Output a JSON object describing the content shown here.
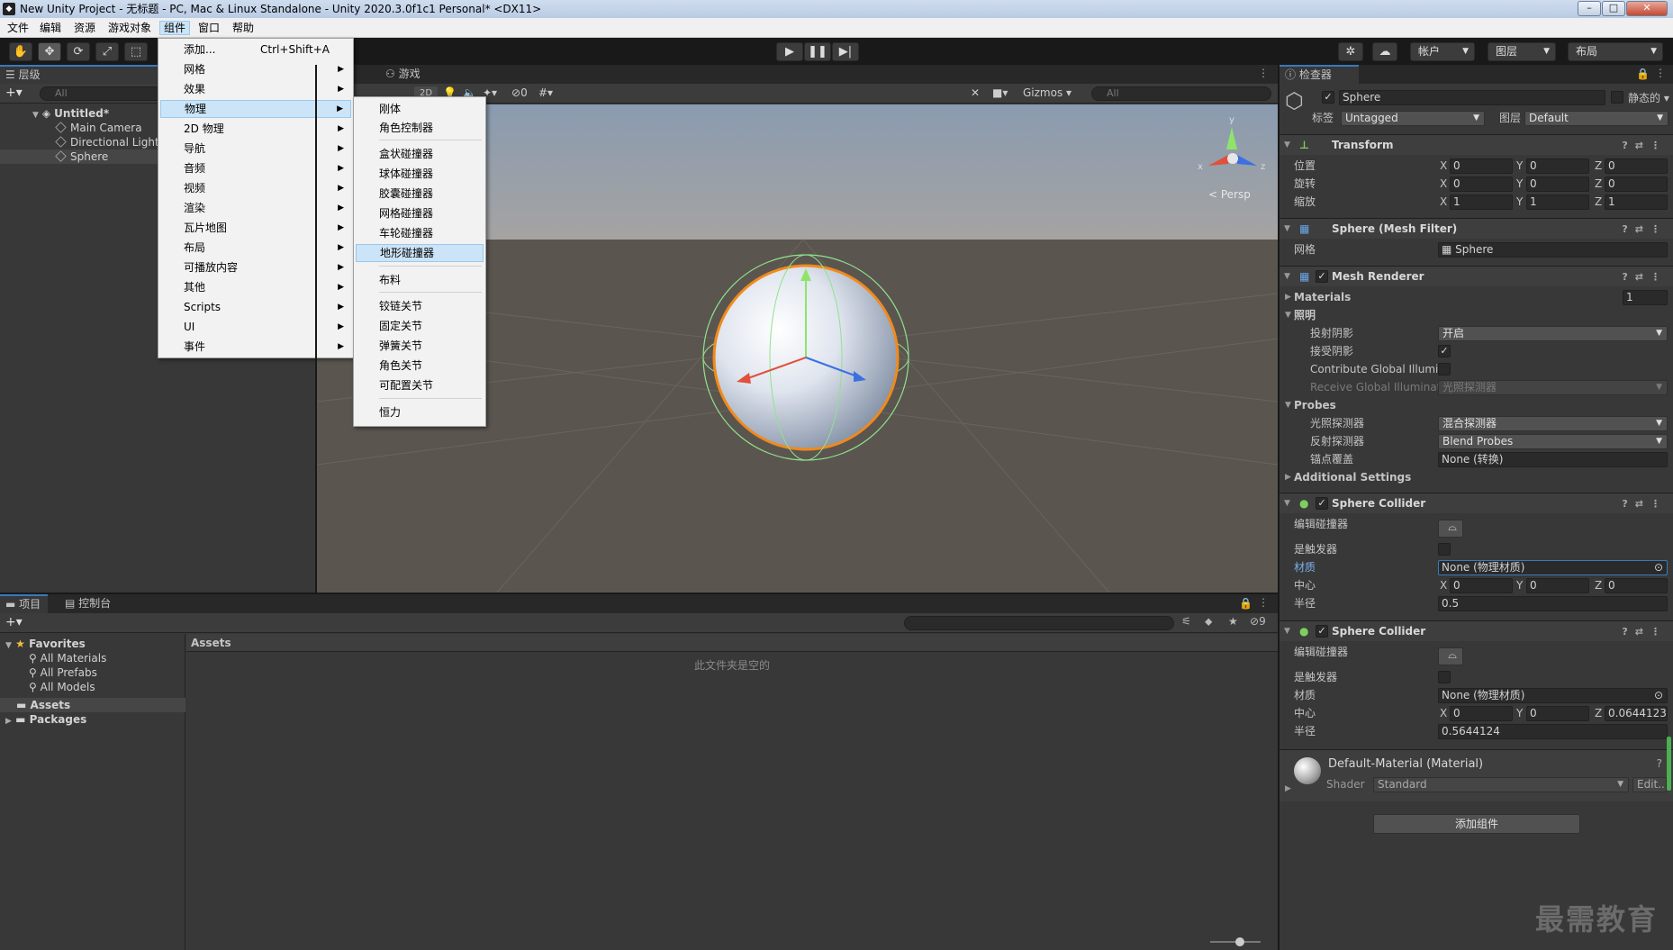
{
  "window": {
    "title": "New Unity Project - 无标题 - PC, Mac & Linux Standalone - Unity 2020.3.0f1c1 Personal* <DX11>",
    "app_icon": "unity-icon"
  },
  "menubar": {
    "items": [
      "文件",
      "编辑",
      "资源",
      "游戏对象",
      "组件",
      "窗口",
      "帮助"
    ],
    "active": "组件"
  },
  "toolbar": {
    "account": "帐户",
    "layers": "图层",
    "layout": "布局"
  },
  "hierarchy": {
    "tab": "层级",
    "search_placeholder": "All",
    "scene": "Untitled*",
    "items": [
      "Main Camera",
      "Directional Light",
      "Sphere"
    ],
    "selected": "Sphere"
  },
  "scene_view": {
    "game_tab": "游戏",
    "mode_2d": "2D",
    "hidden_count": "0",
    "gizmos": "Gizmos",
    "search_placeholder": "All",
    "persp_label": "< Persp",
    "axes": {
      "x": "x",
      "y": "y",
      "z": "z"
    }
  },
  "component_menu": {
    "items": [
      {
        "label": "添加...",
        "shortcut": "Ctrl+Shift+A",
        "submenu": false
      },
      {
        "label": "网格",
        "submenu": true
      },
      {
        "label": "效果",
        "submenu": true
      },
      {
        "label": "物理",
        "submenu": true,
        "highlighted": true
      },
      {
        "label": "2D 物理",
        "submenu": true
      },
      {
        "label": "导航",
        "submenu": true
      },
      {
        "label": "音频",
        "submenu": true
      },
      {
        "label": "视频",
        "submenu": true
      },
      {
        "label": "渲染",
        "submenu": true
      },
      {
        "label": "瓦片地图",
        "submenu": true
      },
      {
        "label": "布局",
        "submenu": true
      },
      {
        "label": "可播放内容",
        "submenu": true
      },
      {
        "label": "其他",
        "submenu": true
      },
      {
        "label": "Scripts",
        "submenu": true
      },
      {
        "label": "UI",
        "submenu": true
      },
      {
        "label": "事件",
        "submenu": true
      }
    ]
  },
  "physics_menu": {
    "groups": [
      [
        "刚体",
        "角色控制器"
      ],
      [
        "盒状碰撞器",
        "球体碰撞器",
        "胶囊碰撞器",
        "网格碰撞器",
        "车轮碰撞器",
        "地形碰撞器"
      ],
      [
        "布料"
      ],
      [
        "铰链关节",
        "固定关节",
        "弹簧关节",
        "角色关节",
        "可配置关节"
      ],
      [
        "恒力"
      ]
    ],
    "highlighted": "地形碰撞器"
  },
  "project": {
    "tabs": [
      "项目",
      "控制台"
    ],
    "hidden_count": "9",
    "favorites_label": "Favorites",
    "favorites": [
      "All Materials",
      "All Prefabs",
      "All Models"
    ],
    "folders": [
      "Assets",
      "Packages"
    ],
    "breadcrumb": "Assets",
    "empty_message": "此文件夹是空的"
  },
  "inspector": {
    "tab": "检查器",
    "object_name": "Sphere",
    "static_label": "静态的",
    "tag_label": "标签",
    "tag_value": "Untagged",
    "layer_label": "图层",
    "layer_value": "Default",
    "transform": {
      "title": "Transform",
      "rows": [
        {
          "label": "位置",
          "x": "0",
          "y": "0",
          "z": "0"
        },
        {
          "label": "旋转",
          "x": "0",
          "y": "0",
          "z": "0"
        },
        {
          "label": "缩放",
          "x": "1",
          "y": "1",
          "z": "1"
        }
      ]
    },
    "mesh_filter": {
      "title": "Sphere (Mesh Filter)",
      "mesh_label": "网格",
      "mesh_value": "Sphere"
    },
    "mesh_renderer": {
      "title": "Mesh Renderer",
      "materials_label": "Materials",
      "materials_count": "1",
      "lighting_label": "照明",
      "cast_shadows_label": "投射阴影",
      "cast_shadows_value": "开启",
      "receive_shadows_label": "接受阴影",
      "contribute_gi_label": "Contribute Global Illumir",
      "receive_gi_label": "Receive Global Illuminati",
      "receive_gi_value": "光照探测器",
      "probes_label": "Probes",
      "light_probes_label": "光照探测器",
      "light_probes_value": "混合探测器",
      "reflection_probes_label": "反射探测器",
      "reflection_probes_value": "Blend Probes",
      "anchor_override_label": "锚点覆盖",
      "anchor_override_value": "None (转换)",
      "additional_settings_label": "Additional Settings"
    },
    "sphere_collider_1": {
      "title": "Sphere Collider",
      "edit_label": "编辑碰撞器",
      "trigger_label": "是触发器",
      "material_label": "材质",
      "material_value": "None (物理材质)",
      "center_label": "中心",
      "center": {
        "x": "0",
        "y": "0",
        "z": "0"
      },
      "radius_label": "半径",
      "radius": "0.5"
    },
    "sphere_collider_2": {
      "title": "Sphere Collider",
      "edit_label": "编辑碰撞器",
      "trigger_label": "是触发器",
      "material_label": "材质",
      "material_value": "None (物理材质)",
      "center_label": "中心",
      "center": {
        "x": "0",
        "y": "0",
        "z": "0.06441236"
      },
      "radius_label": "半径",
      "radius": "0.5644124"
    },
    "material": {
      "title": "Default-Material (Material)",
      "shader_label": "Shader",
      "shader_value": "Standard",
      "edit_label": "Edit..."
    },
    "add_component": "添加组件"
  },
  "watermark": "最需教育",
  "colors": {
    "accent": "#3a79bb",
    "menu_highlight": "#cce4f7",
    "panel": "#383838",
    "scene_ground": "#5b5550"
  }
}
